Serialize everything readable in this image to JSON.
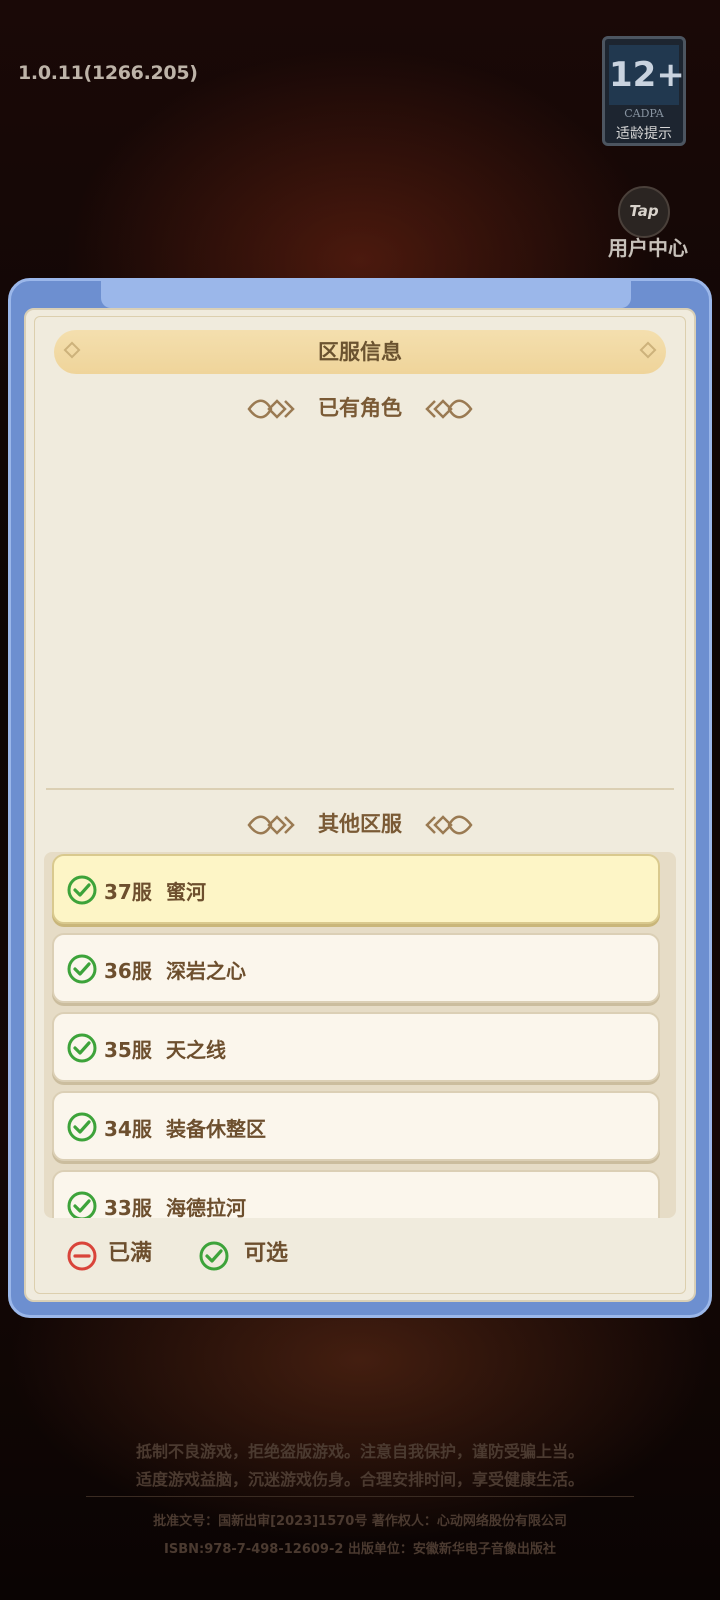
{
  "version": "1.0.11(1266.205)",
  "age_rating": {
    "rating": "12+",
    "org": "CADPA",
    "label": "适龄提示"
  },
  "user_center": {
    "icon_text": "Tap",
    "label": "用户中心"
  },
  "dialog": {
    "title": "区服信息",
    "own_roles_header": "已有角色",
    "other_servers_header": "其他区服",
    "servers": [
      {
        "id": "37服",
        "name": "蜜河",
        "status": "available",
        "selected": true
      },
      {
        "id": "36服",
        "name": "深岩之心",
        "status": "available",
        "selected": false
      },
      {
        "id": "35服",
        "name": "天之线",
        "status": "available",
        "selected": false
      },
      {
        "id": "34服",
        "name": "装备休整区",
        "status": "available",
        "selected": false
      },
      {
        "id": "33服",
        "name": "海德拉河",
        "status": "available",
        "selected": false
      }
    ],
    "legend": {
      "full": "已满",
      "available": "可选"
    }
  },
  "footer": {
    "line1": "抵制不良游戏，拒绝盗版游戏。注意自我保护，谨防受骗上当。",
    "line2": "适度游戏益脑，沉迷游戏伤身。合理安排时间，享受健康生活。",
    "line3": "批准文号：国新出审[2023]1570号  著作权人：心动网络股份有限公司",
    "line4": "ISBN:978-7-498-12609-2      出版单位：安徽新华电子音像出版社"
  },
  "colors": {
    "dialog_border": "#6d8fd0",
    "panel": "#f0ebdd",
    "selected_item": "#fdf5c6",
    "check_green": "#3da33a",
    "full_red": "#d9443a"
  }
}
